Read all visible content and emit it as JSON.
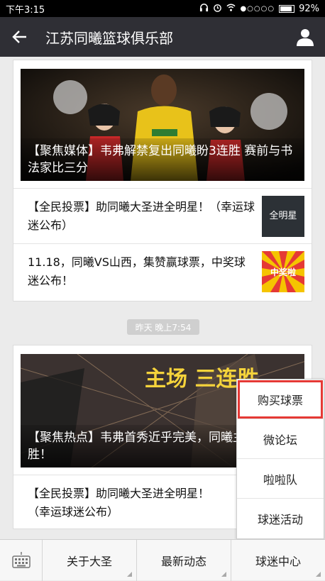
{
  "status": {
    "time": "下午3:15",
    "battery": "92%"
  },
  "header": {
    "title": "江苏同曦篮球俱乐部"
  },
  "card1": {
    "hero_caption": "【聚焦媒体】韦弗解禁复出同曦盼3连胜 赛前与书法家比三分",
    "items": [
      {
        "text": "【全民投票】助同曦大圣进全明星！（幸运球迷公布）",
        "thumb_text": "全明星"
      },
      {
        "text": "11.18，同曦VS山西，集赞赢球票，中奖球迷公布！",
        "thumb_text": "中奖啦"
      }
    ]
  },
  "timestamp": "昨天 晚上7:54",
  "card2": {
    "hero_caption": "【聚焦热点】韦弗首秀近乎完美，同曦主场三连胜！",
    "hero_banner_text": "主场 三连胜",
    "items": [
      {
        "text": "【全民投票】助同曦大圣进全明星！（幸运球迷公布）"
      }
    ]
  },
  "popup_menu": [
    "购买球票",
    "微论坛",
    "啦啦队",
    "球迷活动"
  ],
  "bottom_menu": [
    "关于大圣",
    "最新动态",
    "球迷中心"
  ]
}
